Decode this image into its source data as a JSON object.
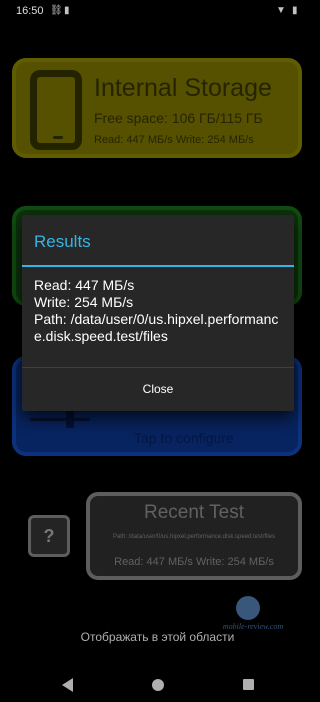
{
  "status_bar": {
    "time": "16:50",
    "icons": [
      "gallery-icon",
      "sim-icon",
      "wifi-icon",
      "battery-icon"
    ]
  },
  "internal_card": {
    "title": "Internal Storage",
    "free_space": "Free space: 106 ГБ/115 ГБ",
    "speed": "Read: 447 МБ/s Write: 254 МБ/s",
    "icon": "phone-icon",
    "color": "#625d00"
  },
  "config_card": {
    "tap_label": "Tap to configure",
    "icon": "slider-icon",
    "color": "#0a2a6e"
  },
  "green_card": {
    "color": "#0f3c0f"
  },
  "help_button": {
    "label": "?"
  },
  "recent_test": {
    "title": "Recent Test",
    "path": "Path: /data/user/0/us.hipxel.performance.disk.speed.test/files",
    "speed": "Read: 447 МБ/s Write: 254 МБ/s"
  },
  "watermark": {
    "text": "mobile-review.com"
  },
  "bottom_text": "Отображать в этой области",
  "dialog": {
    "title": "Results",
    "read": "Read: 447 МБ/s",
    "write": "Write: 254 МБ/s",
    "path": "Path: /data/user/0/us.hipxel.performance.disk.speed.test/files",
    "close_label": "Close",
    "accent_color": "#33b5e5"
  },
  "navbar": {
    "back": "back-icon",
    "home": "home-icon",
    "recents": "recents-icon"
  }
}
